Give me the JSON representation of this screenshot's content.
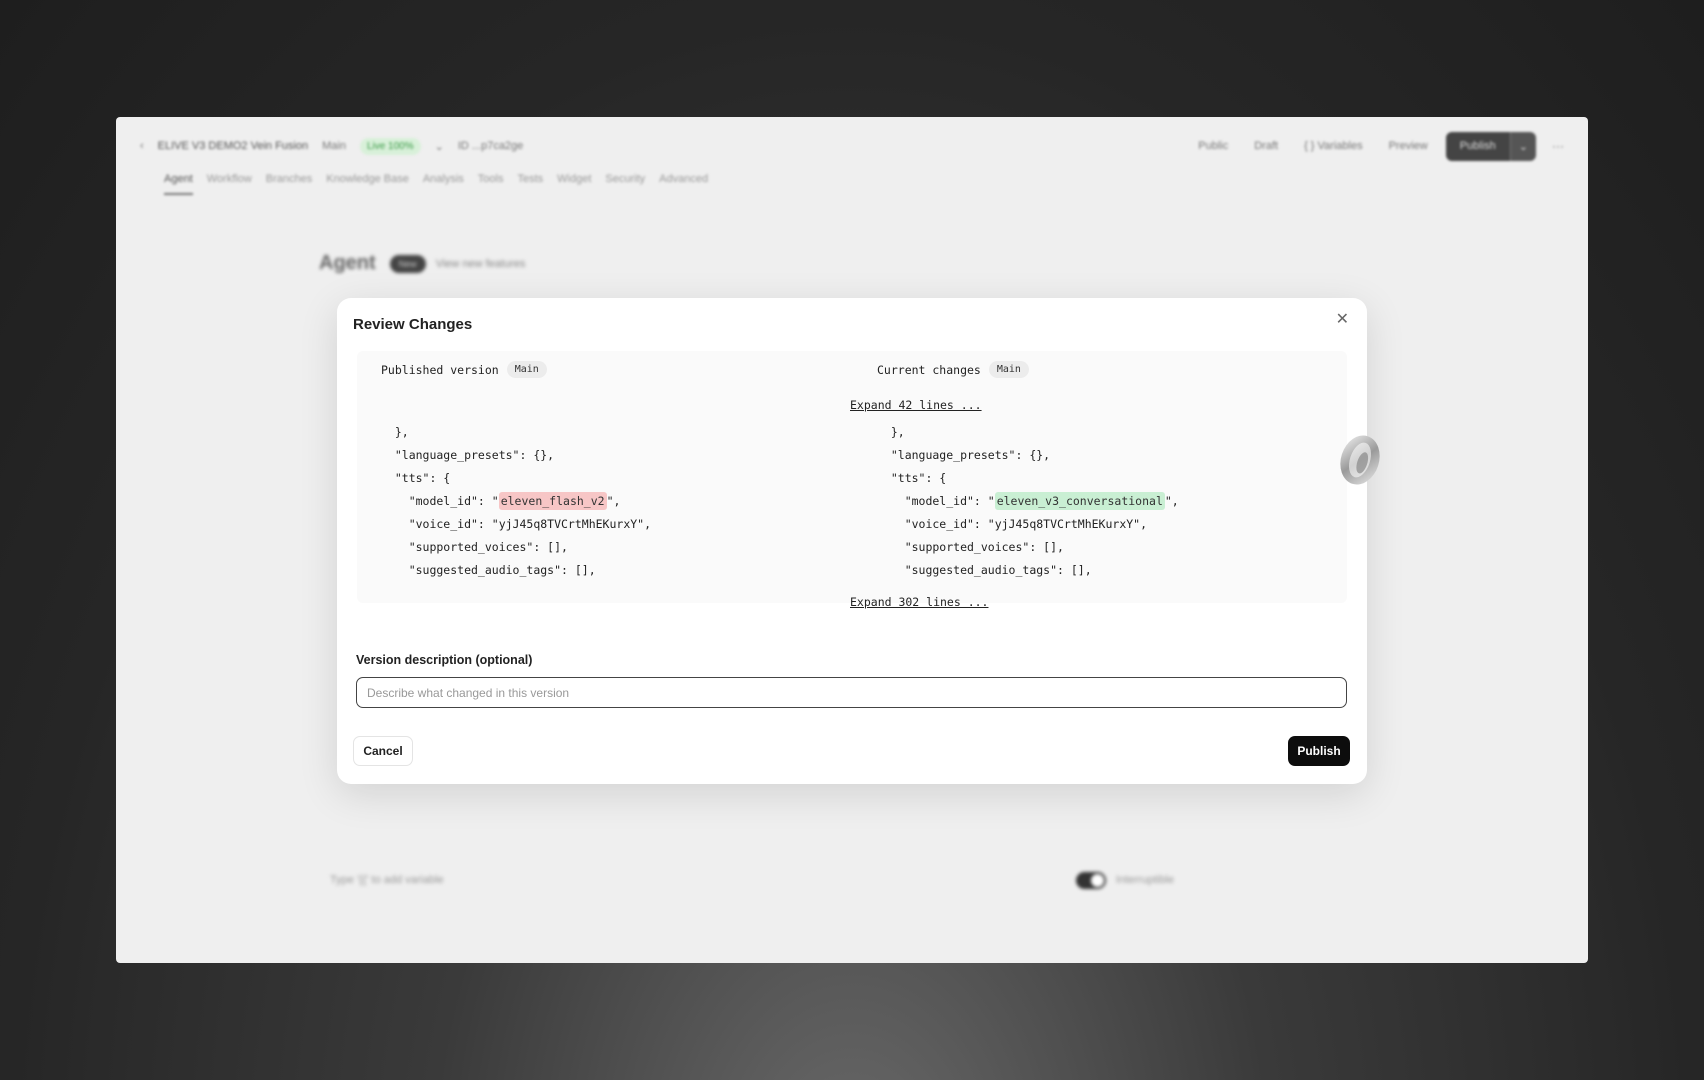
{
  "topbar": {
    "back_icon": "chevron-left-icon",
    "agent_name": "ELIVE V3 DEMO2 Vein Fusion",
    "branch": "Main",
    "live_badge": "Live 100%",
    "branch_menu_icon": "chevron-down-icon",
    "agent_id": "ID ...p7ca2ge",
    "right_items": {
      "public": "Public",
      "draft": "Draft",
      "variables": "Variables",
      "preview": "Preview",
      "publish": "Publish"
    }
  },
  "tabs": [
    "Agent",
    "Workflow",
    "Branches",
    "Knowledge Base",
    "Analysis",
    "Tools",
    "Tests",
    "Widget",
    "Security",
    "Advanced"
  ],
  "background": {
    "heading": "Agent",
    "new_badge": "New",
    "view_features": "View new features",
    "footer_text": "Type '{{' to add variable",
    "toggle_label": "Interruptible"
  },
  "modal": {
    "title": "Review Changes",
    "close_icon": "close-icon",
    "left": {
      "header": "Published version",
      "tag": "Main",
      "lines": [
        {
          "pre": "  },",
          "hl": "",
          "post": ""
        },
        {
          "pre": "  \"language_presets\": {},",
          "hl": "",
          "post": ""
        },
        {
          "pre": "  \"tts\": {",
          "hl": "",
          "post": ""
        },
        {
          "pre": "    \"model_id\": \"",
          "hl": "eleven_flash_v2",
          "post": "\","
        },
        {
          "pre": "    \"voice_id\": \"yjJ45q8TVCrtMhEKurxY\",",
          "hl": "",
          "post": ""
        },
        {
          "pre": "    \"supported_voices\": [],",
          "hl": "",
          "post": ""
        },
        {
          "pre": "    \"suggested_audio_tags\": [],",
          "hl": "",
          "post": ""
        }
      ]
    },
    "right": {
      "header": "Current changes",
      "tag": "Main",
      "lines": [
        {
          "pre": "  },",
          "hl": "",
          "post": ""
        },
        {
          "pre": "  \"language_presets\": {},",
          "hl": "",
          "post": ""
        },
        {
          "pre": "  \"tts\": {",
          "hl": "",
          "post": ""
        },
        {
          "pre": "    \"model_id\": \"",
          "hl": "eleven_v3_conversational",
          "post": "\","
        },
        {
          "pre": "    \"voice_id\": \"yjJ45q8TVCrtMhEKurxY\",",
          "hl": "",
          "post": ""
        },
        {
          "pre": "    \"supported_voices\": [],",
          "hl": "",
          "post": ""
        },
        {
          "pre": "    \"suggested_audio_tags\": [],",
          "hl": "",
          "post": ""
        }
      ]
    },
    "expand_top": "Expand 42 lines ...",
    "expand_bottom": "Expand 302 lines ...",
    "description_label": "Version description (optional)",
    "description_value": "",
    "description_placeholder": "Describe what changed in this version",
    "cancel_label": "Cancel",
    "publish_label": "Publish"
  },
  "colors": {
    "removed_highlight": "#f7c6c6",
    "added_highlight": "#c9efd3",
    "primary_button": "#0d0d0d"
  },
  "decorations": {
    "orb_icon": "agent-orb-icon"
  }
}
